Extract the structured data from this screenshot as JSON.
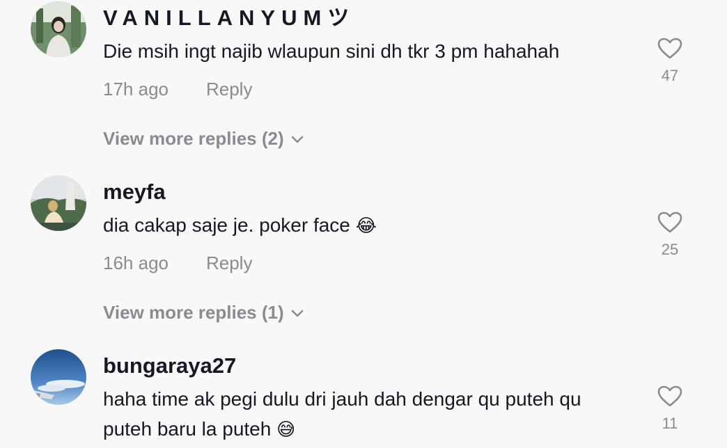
{
  "comments": [
    {
      "username": "VANILLANYUMツ",
      "text": "Die msih ingt najib wlaupun sini dh tkr 3 pm hahahah",
      "time": "17h ago",
      "reply_label": "Reply",
      "likes": "47",
      "view_more": "View more replies (2)"
    },
    {
      "username": "meyfa",
      "text": "dia cakap saje je. poker face",
      "emoji": "😂",
      "time": "16h ago",
      "reply_label": "Reply",
      "likes": "25",
      "view_more": "View more replies (1)"
    },
    {
      "username": "bungaraya27",
      "text": "haha time ak pegi dulu dri jauh dah dengar qu puteh qu puteh baru la puteh",
      "emoji": "😅",
      "likes": "11"
    }
  ],
  "icons": {
    "like": "heart-outline-icon",
    "expand": "chevron-down-icon"
  },
  "colors": {
    "text_primary": "#161823",
    "text_secondary": "#8a8b91",
    "background": "#f8f8f8"
  }
}
